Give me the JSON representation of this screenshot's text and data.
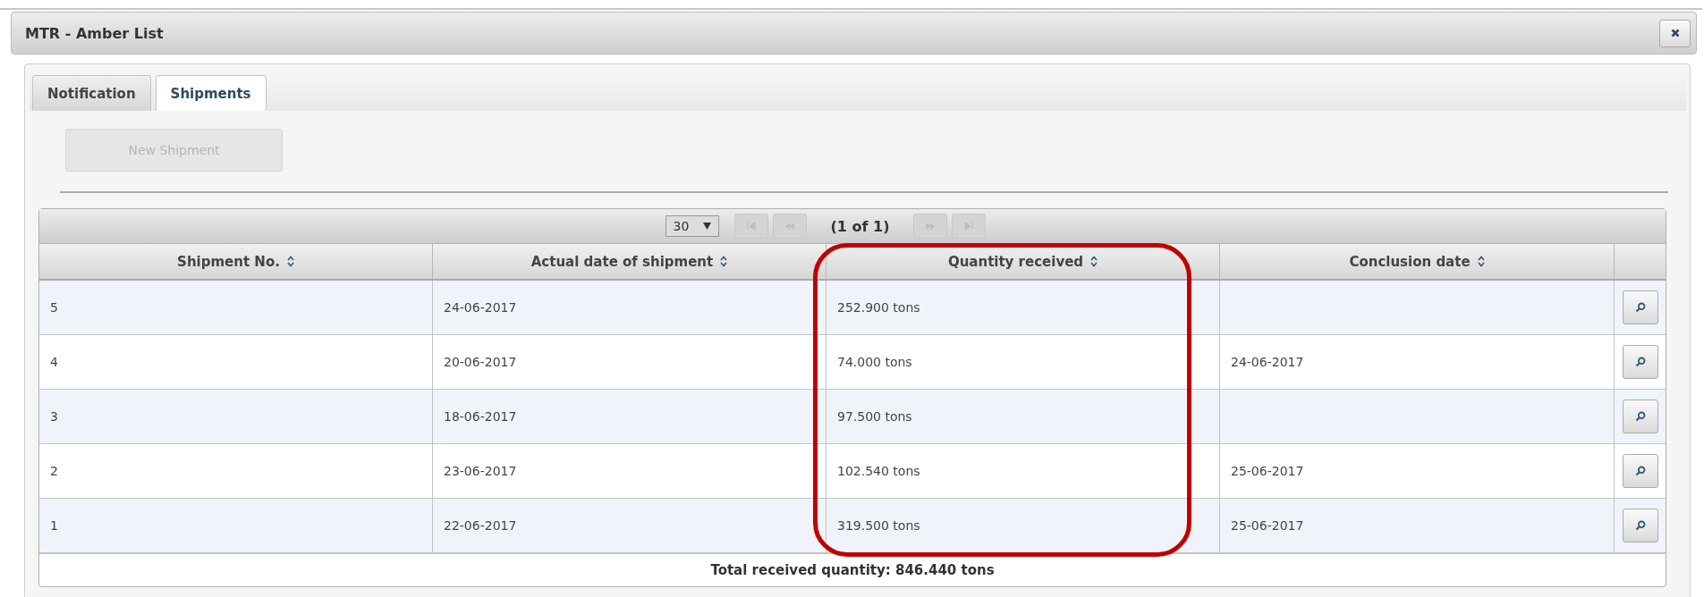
{
  "window": {
    "title": "MTR - Amber List"
  },
  "tabs": [
    {
      "label": "Notification",
      "selected": false
    },
    {
      "label": "Shipments",
      "selected": true
    }
  ],
  "new_button": {
    "label": "New Shipment",
    "disabled": true
  },
  "paginator": {
    "page_size": "30",
    "page_report": "(1 of 1)",
    "first_disabled": true,
    "prev_disabled": true,
    "next_disabled": true,
    "last_disabled": true
  },
  "table": {
    "columns": [
      "Shipment No.",
      "Actual date of shipment",
      "Quantity received",
      "Conclusion date"
    ],
    "rows": [
      {
        "cells": [
          "5",
          "24-06-2017",
          "252.900 tons",
          ""
        ]
      },
      {
        "cells": [
          "4",
          "20-06-2017",
          "74.000 tons",
          "24-06-2017"
        ]
      },
      {
        "cells": [
          "3",
          "18-06-2017",
          "97.500 tons",
          ""
        ]
      },
      {
        "cells": [
          "2",
          "23-06-2017",
          "102.540 tons",
          "25-06-2017"
        ]
      },
      {
        "cells": [
          "1",
          "22-06-2017",
          "319.500 tons",
          "25-06-2017"
        ]
      }
    ],
    "footer": "Total received quantity: 846.440 tons"
  }
}
